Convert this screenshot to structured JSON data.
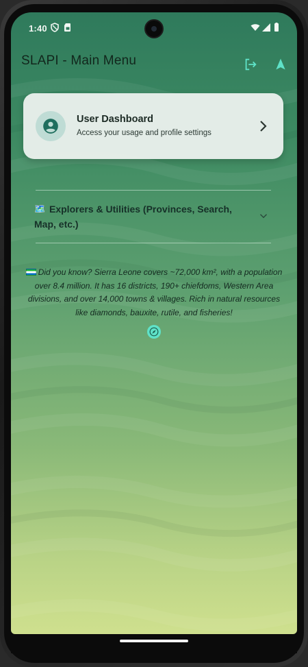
{
  "status_bar": {
    "time": "1:40",
    "icons": [
      "shield-icon",
      "sim-card-icon",
      "wifi-icon",
      "signal-icon",
      "battery-icon"
    ]
  },
  "app_bar": {
    "title": "SLAPI - Main Menu",
    "actions": [
      "logout-icon",
      "navigation-arrow-icon"
    ],
    "accent_color": "#5fe2c8"
  },
  "dashboard_card": {
    "title": "User Dashboard",
    "subtitle": "Access your usage and profile settings",
    "icon": "account-circle-icon"
  },
  "explorers": {
    "icon": "🗺️",
    "label": "Explorers & Utilities (Provinces, Search, Map, etc.)",
    "expanded": false
  },
  "fact": {
    "flag": "🇸🇱",
    "text": "Did you know? Sierra Leone covers ~72,000 km², with a population over 8.4 million. It has 16 districts, 190+ chiefdoms, Western Area divisions, and over 14,000 towns & villages. Rich in natural resources like diamonds, bauxite, rutile, and fisheries!"
  },
  "fab": {
    "icon": "compass-icon"
  },
  "colors": {
    "background_top": "#2f7a5c",
    "background_bottom": "#cfe08e",
    "card_bg": "#ecf1ee",
    "accent": "#5fe2c8"
  }
}
